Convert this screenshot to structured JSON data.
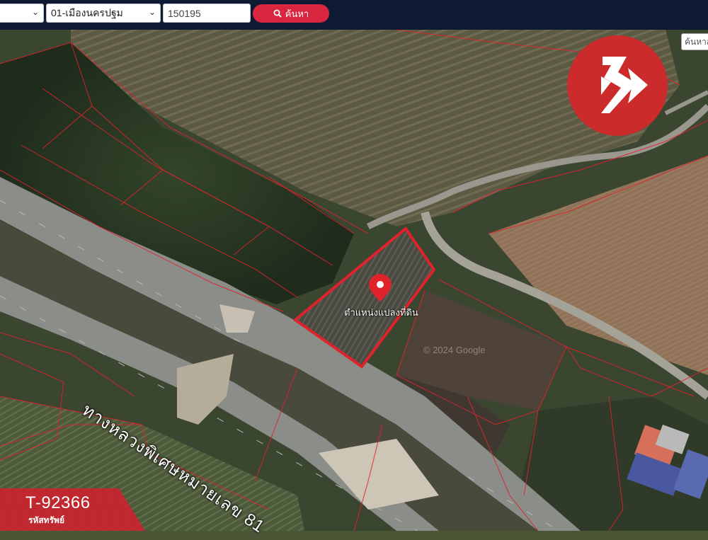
{
  "toolbar": {
    "province_select": "",
    "district_select": "01-เมืองนครปฐม",
    "parcel_input": "150195",
    "search_label": "ค้นหา"
  },
  "map": {
    "search_box": "ค้นหาส",
    "pin_label": "ตำแหน่งแปลงที่ดิน",
    "road_label": "ทางหลวงพิเศษหมายเลข 81",
    "watermark": "© 2024 Google",
    "parcel_color": "#e0222b"
  },
  "listing": {
    "code": "T-92366",
    "code_label": "รหัสทรัพย์"
  },
  "icons": {
    "search": "search-icon",
    "pin": "map-pin-icon",
    "logo": "brand-logo-icon"
  }
}
